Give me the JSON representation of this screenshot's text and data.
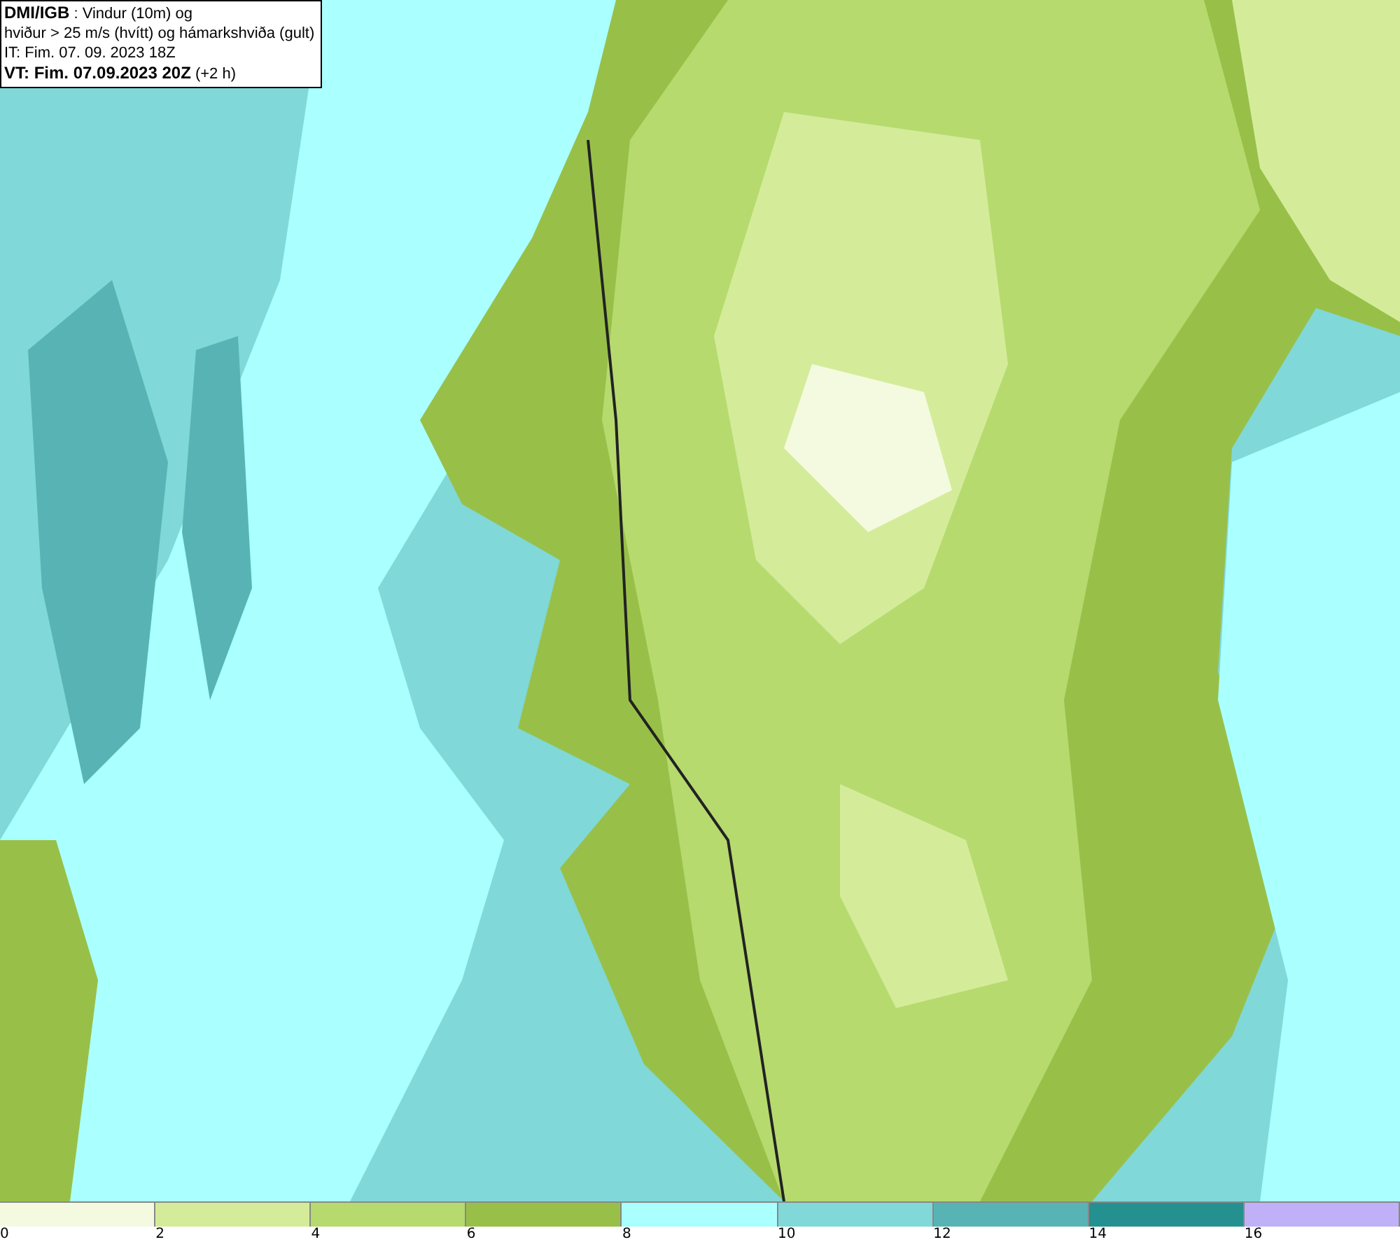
{
  "title_box": {
    "lines": [
      "**DMI/IGB** : Vindur (10m) og",
      "hviður > 25 m/s (hvítt) og hámarkshviða (gult)",
      "IT: Fim. 07. 09. 2023 18Z",
      "**VT: Fim. 07.09.2023 20Z** (+2 h)"
    ]
  },
  "legend": {
    "bins": [
      {
        "color": "#f4fadf"
      },
      {
        "color": "#d4ec9a"
      },
      {
        "color": "#b6da6e"
      },
      {
        "color": "#98c048"
      },
      {
        "color": "#aaffff"
      },
      {
        "color": "#80d8d8"
      },
      {
        "color": "#58b4b4"
      },
      {
        "color": "#259090"
      },
      {
        "color": "#c0b0f8"
      }
    ],
    "ticks": [
      "0",
      "2",
      "4",
      "6",
      "8",
      "10",
      "12",
      "14",
      "16"
    ]
  }
}
